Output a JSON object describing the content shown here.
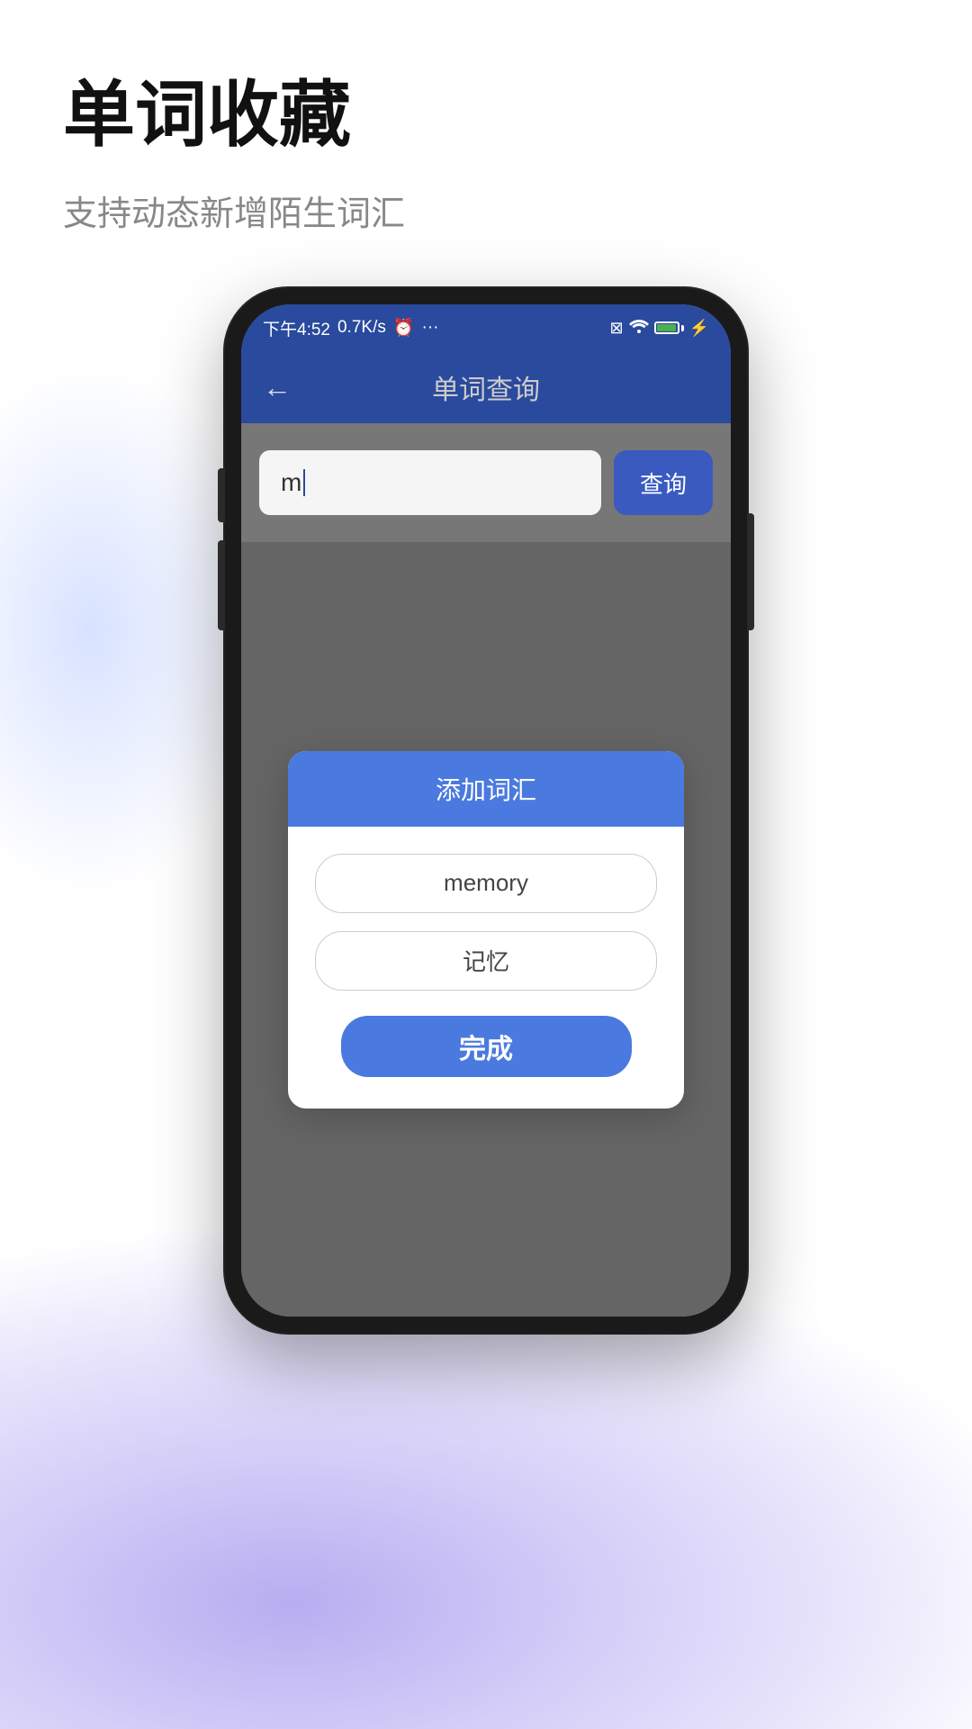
{
  "page": {
    "title": "单词收藏",
    "subtitle": "支持动态新增陌生词汇"
  },
  "status_bar": {
    "time": "下午4:52",
    "speed": "0.7K/s",
    "alarm_icon": "⏰",
    "more_icon": "···",
    "wifi_icon": "wifi",
    "battery_percent": "100"
  },
  "app_header": {
    "back_label": "←",
    "title": "单词查询"
  },
  "search": {
    "input_value": "m",
    "button_label": "查询"
  },
  "dialog": {
    "title": "添加词汇",
    "word_field": "memory",
    "translation_field": "记忆",
    "confirm_label": "完成"
  }
}
